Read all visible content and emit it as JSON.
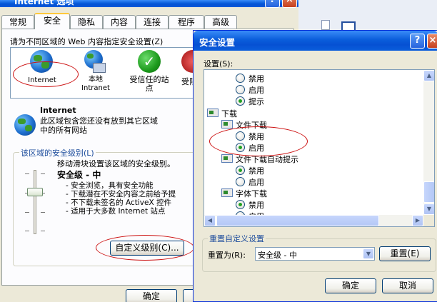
{
  "internet_options": {
    "title": "Internet 选项",
    "tabs": [
      "常规",
      "安全",
      "隐私",
      "内容",
      "连接",
      "程序",
      "高级"
    ],
    "active_tab": "安全",
    "zone_prompt": "请为不同区域的 Web 内容指定安全设置(Z)",
    "zones": [
      {
        "label": "Internet",
        "icon": "globe-icon"
      },
      {
        "label": "本地\nIntranet",
        "icon": "computer-globe-icon"
      },
      {
        "label": "受信任的站\n点",
        "icon": "check-icon"
      },
      {
        "label": "受限制的站点",
        "icon": "restricted-icon"
      }
    ],
    "selected_zone": {
      "name": "Internet",
      "desc1": "此区域包含您还没有放到其它区域",
      "desc2": "中的所有网站"
    },
    "security_level": {
      "group_label": "该区域的安全级别(L)",
      "hint": "移动滑块设置该区域的安全级别。",
      "level": "安全级 - 中",
      "bullets": [
        "- 安全浏览，具有安全功能",
        "- 下载潜在不安全内容之前给予提",
        "- 不下载未签名的 ActiveX 控件",
        "- 适用于大多数 Internet 站点"
      ]
    },
    "custom_level_button": "自定义级别(C)...",
    "ok_button": "确定"
  },
  "security_settings": {
    "title": "安全设置",
    "settings_label": "设置(S):",
    "tree": [
      {
        "kind": "radio",
        "label": "禁用",
        "checked": false
      },
      {
        "kind": "radio",
        "label": "启用",
        "checked": false
      },
      {
        "kind": "radio",
        "label": "提示",
        "checked": true
      },
      {
        "kind": "folder",
        "label": "下载"
      },
      {
        "kind": "subfolder",
        "label": "文件下载"
      },
      {
        "kind": "radio",
        "label": "禁用",
        "checked": false
      },
      {
        "kind": "radio",
        "label": "启用",
        "checked": true
      },
      {
        "kind": "subfolder",
        "label": "文件下载自动提示"
      },
      {
        "kind": "radio",
        "label": "禁用",
        "checked": true
      },
      {
        "kind": "radio",
        "label": "启用",
        "checked": false
      },
      {
        "kind": "subfolder",
        "label": "字体下载"
      },
      {
        "kind": "radio",
        "label": "禁用",
        "checked": true
      },
      {
        "kind": "radio",
        "label": "启用",
        "checked": false
      }
    ],
    "reset_group_label": "重置自定义设置",
    "reset_to_label": "重置为(R):",
    "reset_select_value": "安全级 - 中",
    "reset_button": "重置(E)",
    "ok_button": "确定",
    "cancel_button": "取消"
  },
  "colors": {
    "title_bar": "#0a5ddb",
    "highlight_ellipse": "#cc1010",
    "radio_checked": "#21a121",
    "dialog_background": "#d4d0c8"
  }
}
